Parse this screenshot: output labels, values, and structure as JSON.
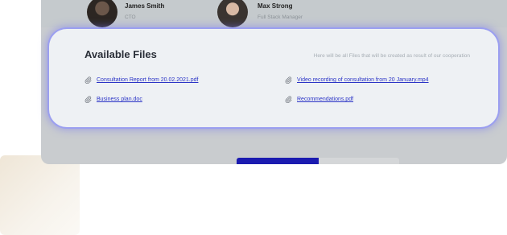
{
  "team": {
    "members": [
      {
        "name": "James Smith",
        "role": "CTO"
      },
      {
        "name": "Max Strong",
        "role": "Full Stack Manager"
      }
    ]
  },
  "files_card": {
    "title": "Available Files",
    "subtitle": "Here will be all Files that will be created as result of our cooperation",
    "files": [
      {
        "label": "Consultation Report from 20.02.2021.pdf",
        "icon": "paperclip-icon"
      },
      {
        "label": "Video recording of consultation from 20 January.mp4",
        "icon": "paperclip-icon"
      },
      {
        "label": "Business plan.doc",
        "icon": "paperclip-icon"
      },
      {
        "label": "Recommendations.pdf",
        "icon": "paperclip-icon"
      }
    ]
  },
  "colors": {
    "accent": "#1b1bb0",
    "link": "#2b34c6",
    "card_glow": "#9b9ff0"
  }
}
